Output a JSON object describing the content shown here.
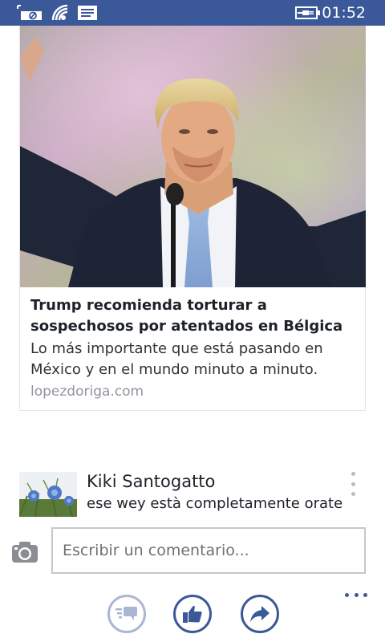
{
  "status_bar": {
    "time": "01:52",
    "background": "#3b5998",
    "icons": [
      "no-sim-icon",
      "wifi-icon",
      "message-icon",
      "battery-charging-icon"
    ]
  },
  "link_card": {
    "image": "trump-speech-photo",
    "title": "Trump recomienda torturar a sospechosos por atentados en Bélgica",
    "description": "Lo más importante que está pasando en México y en el mundo minuto a minuto.",
    "domain": "lopezdoriga.com"
  },
  "comment": {
    "author": "Kiki Santogatto",
    "text": "ese wey està completamente orate",
    "avatar": "blue-flowers-avatar",
    "menu_icon": "vertical-ellipsis-icon"
  },
  "composer": {
    "placeholder": "Escribir un comentario...",
    "camera_icon": "camera-icon"
  },
  "actions": {
    "accent": "#3b5998",
    "buttons": [
      "comments-icon",
      "like-icon",
      "share-icon"
    ],
    "more_icon": "more-icon"
  }
}
